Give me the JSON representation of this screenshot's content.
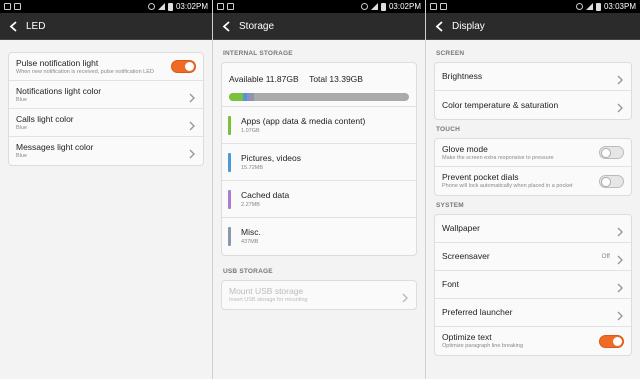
{
  "status_bars": [
    {
      "time": "03:02PM"
    },
    {
      "time": "03:02PM"
    },
    {
      "time": "03:03PM"
    }
  ],
  "led": {
    "title": "LED",
    "items": [
      {
        "title": "Pulse notification light",
        "subtitle": "When new notification is received, pulse notification LED",
        "toggle": "on"
      },
      {
        "title": "Notifications light color",
        "subtitle": "Blue"
      },
      {
        "title": "Calls light color",
        "subtitle": "Blue"
      },
      {
        "title": "Messages light color",
        "subtitle": "Blue"
      }
    ]
  },
  "storage": {
    "title": "Storage",
    "internal_header": "INTERNAL STORAGE",
    "available": "Available 11.87GB",
    "total": "Total 13.39GB",
    "usage_fraction": {
      "apps": 0.08,
      "pictures": 0.02,
      "cached": 0.01,
      "misc": 0.03
    },
    "items": [
      {
        "title": "Apps (app data & media content)",
        "size": "1.07GB",
        "color": "#7dc03b"
      },
      {
        "title": "Pictures, videos",
        "size": "15.72MB",
        "color": "#4a9ad8"
      },
      {
        "title": "Cached data",
        "size": "2.27MB",
        "color": "#a97ed0"
      },
      {
        "title": "Misc.",
        "size": "437MB",
        "color": "#8a97ad"
      }
    ],
    "usb_header": "USB STORAGE",
    "usb": {
      "title": "Mount USB storage",
      "subtitle": "Insert USB storage for mounting"
    }
  },
  "display": {
    "title": "Display",
    "screen_header": "SCREEN",
    "brightness": "Brightness",
    "color_temp": "Color temperature & saturation",
    "touch_header": "TOUCH",
    "glove": {
      "title": "Glove mode",
      "subtitle": "Make the screen extra responsive to pressure",
      "toggle": "off"
    },
    "pocket": {
      "title": "Prevent pocket dials",
      "subtitle": "Phone will lock automatically when placed in a pocket",
      "toggle": "off"
    },
    "system_header": "SYSTEM",
    "wallpaper": "Wallpaper",
    "screensaver": "Screensaver",
    "screensaver_value": "Off",
    "font": "Font",
    "launcher": "Preferred launcher",
    "optimize": {
      "title": "Optimize text",
      "subtitle": "Optimize paragraph line breaking",
      "toggle": "on"
    }
  },
  "colors": {
    "accent": "#ef6a24",
    "appbar": "#2b2b2b"
  }
}
